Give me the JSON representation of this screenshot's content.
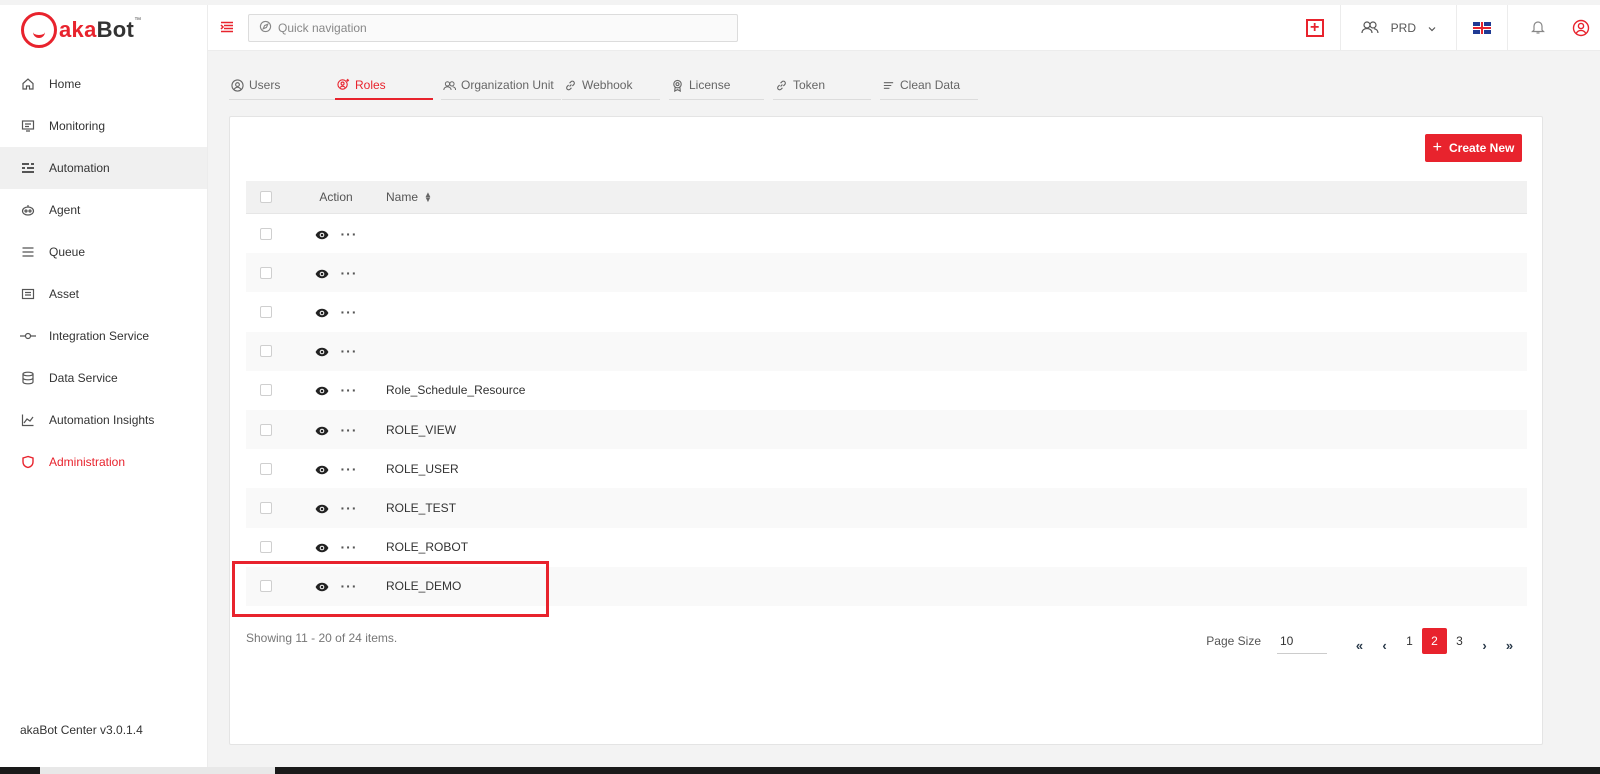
{
  "app": {
    "logo_text_a": "aka",
    "logo_text_b": "Bot",
    "logo_tm": "™",
    "version": "akaBot Center v3.0.1.4"
  },
  "sidebar": {
    "items": [
      {
        "label": "Home",
        "icon": "home-icon"
      },
      {
        "label": "Monitoring",
        "icon": "monitor-icon"
      },
      {
        "label": "Automation",
        "icon": "automation-icon"
      },
      {
        "label": "Agent",
        "icon": "agent-icon"
      },
      {
        "label": "Queue",
        "icon": "queue-icon"
      },
      {
        "label": "Asset",
        "icon": "asset-icon"
      },
      {
        "label": "Integration Service",
        "icon": "integration-icon"
      },
      {
        "label": "Data Service",
        "icon": "database-icon"
      },
      {
        "label": "Automation Insights",
        "icon": "chart-icon"
      },
      {
        "label": "Administration",
        "icon": "shield-icon"
      }
    ],
    "hovered": "Automation",
    "active": "Administration"
  },
  "topbar": {
    "search_placeholder": "Quick navigation",
    "env_label": "PRD"
  },
  "tabs": [
    {
      "label": "Users",
      "icon": "user-icon"
    },
    {
      "label": "Roles",
      "icon": "roles-icon",
      "active": true
    },
    {
      "label": "Organization Unit",
      "icon": "org-icon"
    },
    {
      "label": "Webhook",
      "icon": "link-icon"
    },
    {
      "label": "License",
      "icon": "license-icon"
    },
    {
      "label": "Token",
      "icon": "link-icon"
    },
    {
      "label": "Clean Data",
      "icon": "clean-icon"
    }
  ],
  "toolbar": {
    "create_label": "Create New"
  },
  "grid": {
    "headers": {
      "action": "Action",
      "name": "Name"
    },
    "rows": [
      {
        "name": ""
      },
      {
        "name": ""
      },
      {
        "name": ""
      },
      {
        "name": ""
      },
      {
        "name": "Role_Schedule_Resource"
      },
      {
        "name": "ROLE_VIEW"
      },
      {
        "name": "ROLE_USER"
      },
      {
        "name": "ROLE_TEST"
      },
      {
        "name": "ROLE_ROBOT"
      },
      {
        "name": "ROLE_DEMO"
      }
    ]
  },
  "footer": {
    "showing": "Showing 11 - 20 of 24 items.",
    "page_size_label": "Page Size",
    "page_size": "10",
    "pages": [
      "1",
      "2",
      "3"
    ],
    "current_page": "2"
  },
  "colors": {
    "accent": "#e8232d"
  }
}
